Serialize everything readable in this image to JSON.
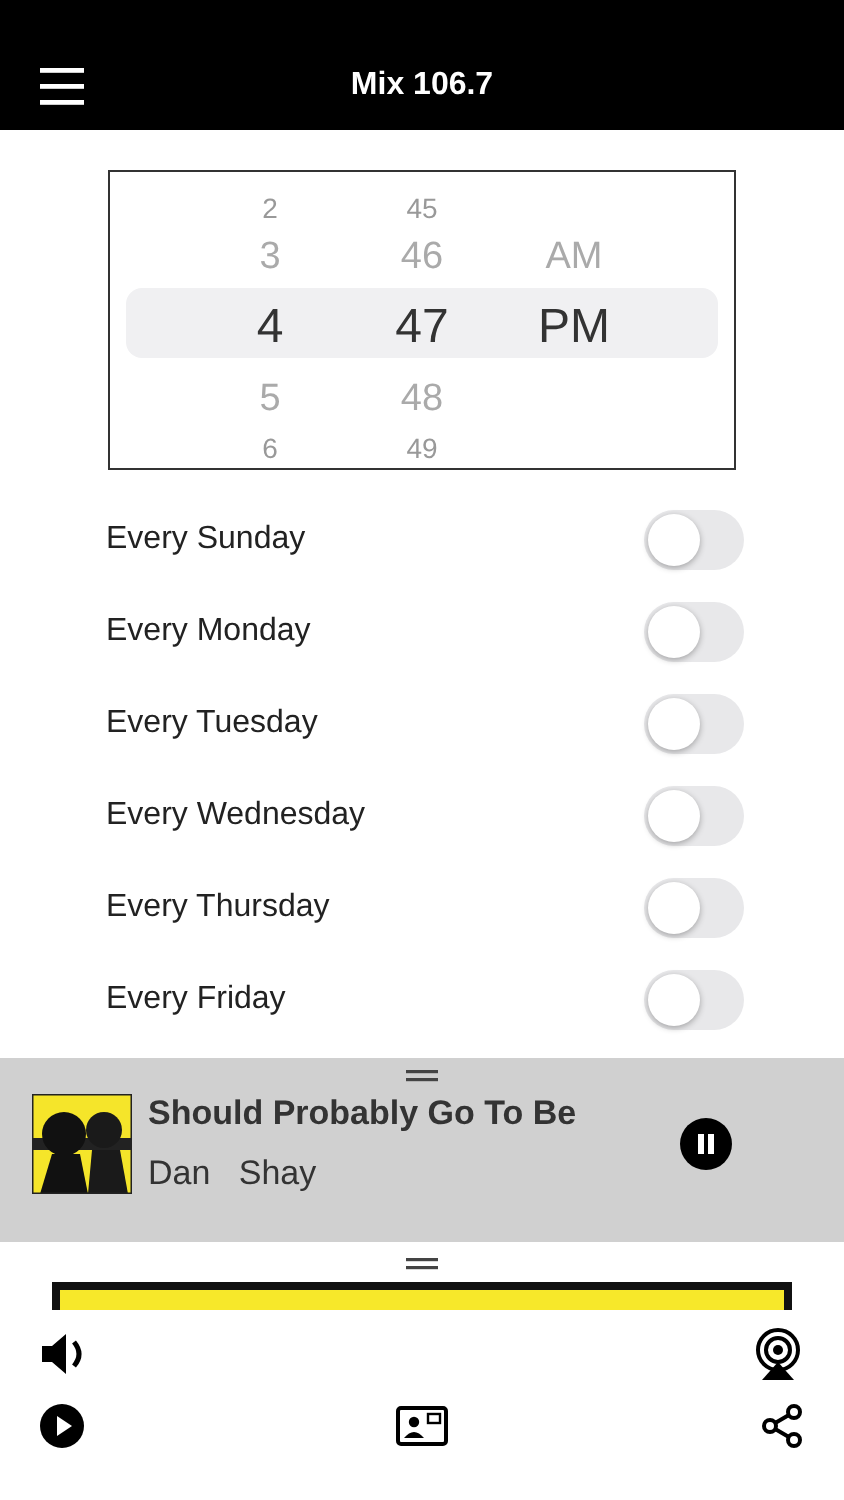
{
  "header": {
    "title": "Mix 106.7"
  },
  "picker": {
    "columns": [
      {
        "items": [
          {
            "label": "2",
            "selected": false
          },
          {
            "label": "3",
            "selected": false
          },
          {
            "label": "4",
            "selected": true
          },
          {
            "label": "5",
            "selected": false
          },
          {
            "label": "6",
            "selected": false
          }
        ]
      },
      {
        "items": [
          {
            "label": "45",
            "selected": false
          },
          {
            "label": "46",
            "selected": false
          },
          {
            "label": "47",
            "selected": true
          },
          {
            "label": "48",
            "selected": false
          },
          {
            "label": "49",
            "selected": false
          }
        ]
      },
      {
        "items": [
          {
            "label": "AM",
            "selected": false
          },
          {
            "label": "PM",
            "selected": true
          }
        ]
      }
    ]
  },
  "days": [
    {
      "label": "Every Sunday",
      "on": false
    },
    {
      "label": "Every Monday",
      "on": false
    },
    {
      "label": "Every Tuesday",
      "on": false
    },
    {
      "label": "Every Wednesday",
      "on": false
    },
    {
      "label": "Every Thursday",
      "on": false
    },
    {
      "label": "Every Friday",
      "on": false
    }
  ],
  "now_playing": {
    "title": "Should Probably Go To Be",
    "artist": "Dan   Shay",
    "playing": true
  },
  "volume": {
    "level": 1
  }
}
